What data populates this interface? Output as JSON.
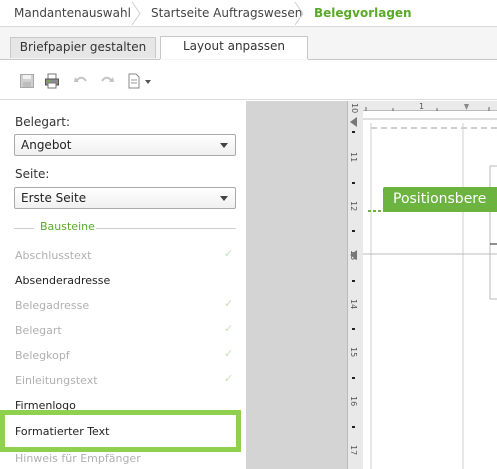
{
  "breadcrumb": {
    "items": [
      "Mandantenauswahl",
      "Startseite Auftragswesen",
      "Belegvorlagen"
    ]
  },
  "tabs": {
    "items": [
      "Briefpapier gestalten",
      "Layout anpassen"
    ],
    "active": "Layout anpassen"
  },
  "toolbar": {
    "icons": [
      "save-icon",
      "print-icon",
      "undo-icon",
      "redo-icon",
      "document-icon",
      "dropdown-arrow-icon"
    ]
  },
  "panel": {
    "belegart_label": "Belegart:",
    "belegart_value": "Angebot",
    "seite_label": "Seite:",
    "seite_value": "Erste Seite",
    "section_title": "Bausteine",
    "items": [
      {
        "label": "Abschlusstext",
        "enabled": false,
        "checked": true
      },
      {
        "label": "Absenderadresse",
        "enabled": true,
        "checked": false
      },
      {
        "label": "Belegadresse",
        "enabled": false,
        "checked": true
      },
      {
        "label": "Belegart",
        "enabled": false,
        "checked": true
      },
      {
        "label": "Belegkopf",
        "enabled": false,
        "checked": true
      },
      {
        "label": "Einleitungstext",
        "enabled": false,
        "checked": true
      },
      {
        "label": "Firmenlogo",
        "enabled": true,
        "checked": false
      },
      {
        "label": "Formatierter Text",
        "enabled": true,
        "checked": false
      },
      {
        "label": "Hinweis für Empfänger",
        "enabled": false,
        "checked": false
      }
    ]
  },
  "canvas": {
    "ruler_top": [
      "10",
      "1"
    ],
    "ruler_left": [
      "11",
      "12",
      "13",
      "14",
      "15",
      "16",
      "17"
    ],
    "position_tag": "Positionsbere"
  },
  "colors": {
    "accent_green": "#5aaa2a",
    "highlight_green": "#8fd14f",
    "tag_green": "#6cb33f"
  }
}
